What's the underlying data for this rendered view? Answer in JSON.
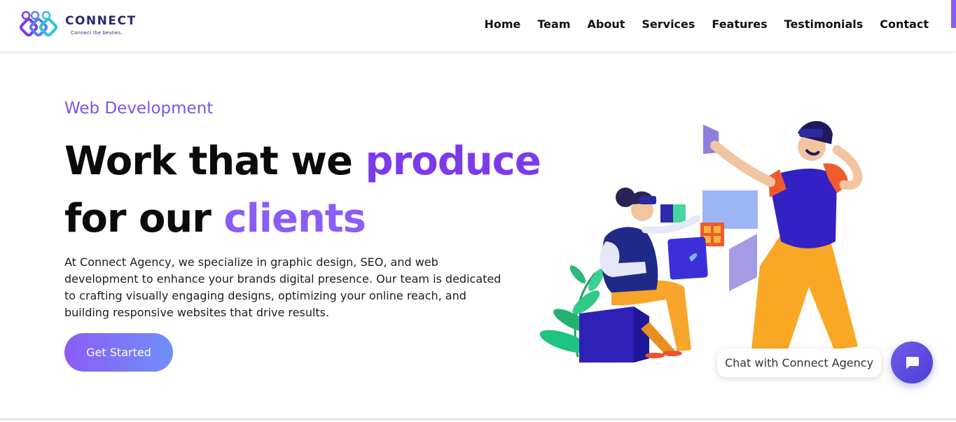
{
  "brand": {
    "name": "CONNECT",
    "tagline": "Connect the beuties."
  },
  "nav": {
    "items": [
      "Home",
      "Team",
      "About",
      "Services",
      "Features",
      "Testimonials",
      "Contact"
    ]
  },
  "hero": {
    "eyebrow": "Web Development",
    "headline_line1_plain": "Work that we ",
    "headline_line1_accent": "produce",
    "headline_line2_plain": "for our ",
    "headline_line2_accent": "clients",
    "description": "At Connect Agency, we specialize in graphic design, SEO, and web development to enhance your brands digital presence. Our team is dedicated to crafting visually engaging designs, optimizing your online reach, and building responsive websites that drive results.",
    "cta_label": "Get Started"
  },
  "chat": {
    "label": "Chat with Connect Agency",
    "icon": "chat-icon"
  },
  "colors": {
    "accent": "#7c3aed",
    "accent_light": "#8b5cf6",
    "nav_text": "#111111"
  }
}
